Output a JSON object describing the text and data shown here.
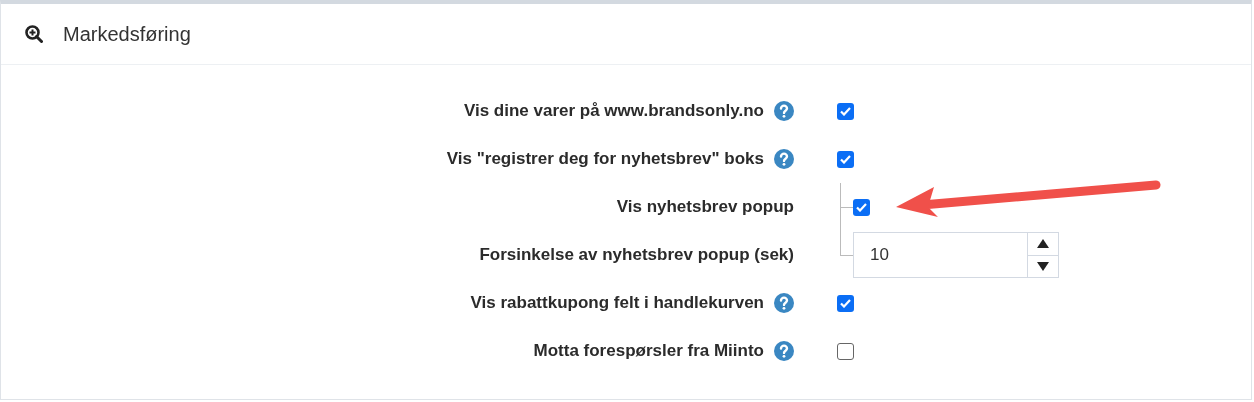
{
  "panel": {
    "title": "Markedsføring"
  },
  "settings": [
    {
      "kind": "checkbox",
      "label": "Vis dine varer på www.brandsonly.no",
      "help": true,
      "checked": true
    },
    {
      "kind": "checkbox",
      "label": "Vis \"registrer deg for nyhetsbrev\" boks",
      "help": true,
      "checked": true,
      "children": [
        {
          "kind": "checkbox",
          "label": "Vis nyhetsbrev popup",
          "help": false,
          "checked": true
        },
        {
          "kind": "number",
          "label": "Forsinkelse av nyhetsbrev popup (sek)",
          "help": false,
          "value": "10"
        }
      ]
    },
    {
      "kind": "checkbox",
      "label": "Vis rabattkupong felt i handlekurven",
      "help": true,
      "checked": true
    },
    {
      "kind": "checkbox",
      "label": "Motta forespørsler fra Miinto",
      "help": true,
      "checked": false
    }
  ]
}
